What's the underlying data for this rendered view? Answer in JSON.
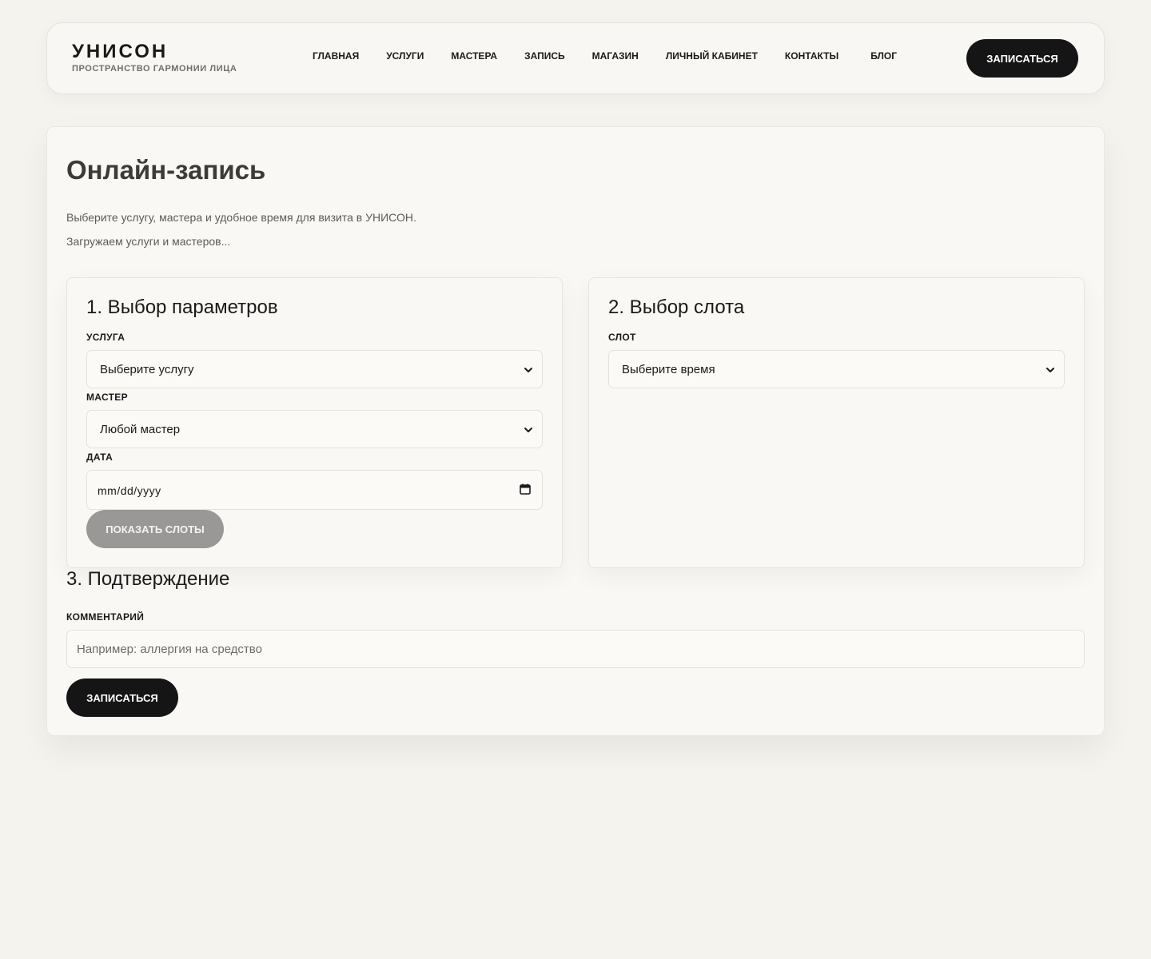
{
  "header": {
    "brand_name": "УНИСОН",
    "brand_tagline": "ПРОСТРАНСТВО ГАРМОНИИ ЛИЦА",
    "nav": [
      {
        "label": "ГЛАВНАЯ"
      },
      {
        "label": "УСЛУГИ"
      },
      {
        "label": "МАСТЕРА"
      },
      {
        "label": "ЗАПИСЬ"
      },
      {
        "label": "МАГАЗИН"
      },
      {
        "label": "ЛИЧНЫЙ КАБИНЕТ"
      },
      {
        "label": "КОНТАКТЫ"
      },
      {
        "label": "БЛОГ"
      }
    ],
    "cta_label": "ЗАПИСАТЬСЯ"
  },
  "main": {
    "title": "Онлайн-запись",
    "subtitle": "Выберите услугу, мастера и удобное время для визита в УНИСОН.",
    "loading_text": "Загружаем услуги и мастеров...",
    "params_panel": {
      "title": "1. Выбор параметров",
      "service_label": "УСЛУГА",
      "service_value": "Выберите услугу",
      "master_label": "МАСТЕР",
      "master_value": "Любой мастер",
      "date_label": "ДАТА",
      "date_placeholder": "mm/dd/yyyy",
      "show_slots_label": "ПОКАЗАТЬ СЛОТЫ"
    },
    "slot_panel": {
      "title": "2. Выбор слота",
      "slot_label": "СЛОТ",
      "slot_value": "Выберите время"
    },
    "confirm": {
      "title": "3. Подтверждение",
      "comment_label": "КОММЕНТАРИЙ",
      "comment_placeholder": "Например: аллергия на средство",
      "submit_label": "ЗАПИСАТЬСЯ"
    }
  },
  "icons": {
    "select": "chevron-down-icon",
    "date": "calendar-icon"
  },
  "colors": {
    "background": "#f5f3ee",
    "card": "#faf8f4",
    "primary_button": "#151515",
    "disabled_button": "#999896"
  }
}
